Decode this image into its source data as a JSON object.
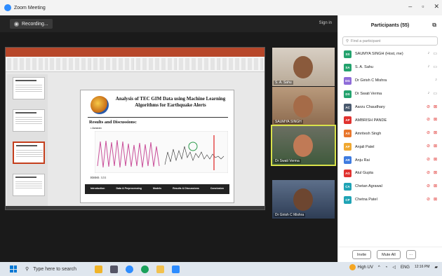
{
  "window": {
    "title": "Zoom Meeting",
    "controls": [
      "–",
      "▫",
      "✕"
    ]
  },
  "meeting": {
    "recording_label": "Recording...",
    "sign_in_label": "Sign in"
  },
  "slide": {
    "title": "Analysis of TEC GIM Data using Machine Learning Algorithms for Earthquake Alerts",
    "section": "Results and Discussions:",
    "bullet": "• Awaran",
    "rmse": "RMSE: 3.51",
    "flow_steps": [
      "Introduction",
      "Data & Preprocessing",
      "Models",
      "Results & Discussions",
      "Conclusion"
    ]
  },
  "video_tiles": [
    {
      "name": "S. A. Sahu"
    },
    {
      "name": "SAUMYA SINGH"
    },
    {
      "name": "Dr Swati Verma",
      "speaking": true
    },
    {
      "name": "Dr Girish C Mishra"
    }
  ],
  "participants_panel": {
    "title": "Participants (55)",
    "find_placeholder": "Find a participant",
    "invite_label": "Invite",
    "mute_all_label": "Mute All",
    "more_label": "···",
    "list": [
      {
        "initials": "SS",
        "name": "SAUMYA SINGH (Host, me)",
        "color": "#23a26d",
        "mic": "on",
        "cam": "on"
      },
      {
        "initials": "SA",
        "name": "S. A. Sahu",
        "color": "#23a26d",
        "mic": "on",
        "cam": "on"
      },
      {
        "initials": "DG",
        "name": "Dr Girish C Mishra",
        "color": "#8e6bd8",
        "mic": "on",
        "cam": "none"
      },
      {
        "initials": "DS",
        "name": "Dr Swati Verma",
        "color": "#23a26d",
        "mic": "on",
        "cam": "on"
      },
      {
        "initials": "AC",
        "name": "Aarzu Chaudhary",
        "color": "#4a5a6e",
        "mic": "muted",
        "cam": "off"
      },
      {
        "initials": "AP",
        "name": "AMBRISH PANDE",
        "color": "#e0322f",
        "mic": "muted",
        "cam": "off"
      },
      {
        "initials": "AS",
        "name": "Amritesh Singh",
        "color": "#e8762c",
        "mic": "muted",
        "cam": "off"
      },
      {
        "initials": "AP",
        "name": "Anjali Patel",
        "color": "#f0a830",
        "mic": "muted",
        "cam": "off"
      },
      {
        "initials": "AR",
        "name": "Anju Rai",
        "color": "#3d7be0",
        "mic": "muted",
        "cam": "off"
      },
      {
        "initials": "AG",
        "name": "Atul Gupta",
        "color": "#e0322f",
        "mic": "muted",
        "cam": "off"
      },
      {
        "initials": "CA",
        "name": "Chetan Agrawal",
        "color": "#1fa3b5",
        "mic": "muted",
        "cam": "off"
      },
      {
        "initials": "CP",
        "name": "Chetna Patel",
        "color": "#1fa3b5",
        "mic": "muted",
        "cam": "off"
      }
    ]
  },
  "taskbar": {
    "search_placeholder": "Type here to search",
    "weather": "High UV",
    "language": "ENG",
    "time": "12:16 PM"
  },
  "colors": {
    "zoom_blue": "#2d8cff",
    "muted_red": "#e0322f",
    "speaker_outline": "#d9e24b"
  }
}
